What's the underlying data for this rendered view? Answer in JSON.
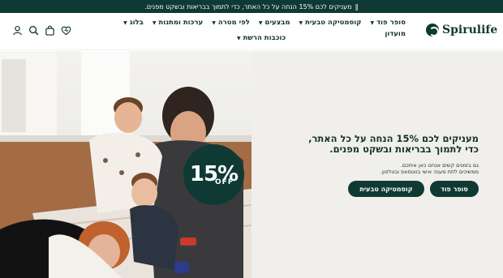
{
  "announcement": {
    "text": "מעניקים לכם 15% הנחה על כל האתר, כדי לתמוך בבריאות ובשקט מפנים.",
    "separator": "‖"
  },
  "brand": {
    "name": "Spirulife"
  },
  "nav": {
    "items": [
      {
        "label": "סופר פוד",
        "has_dropdown": true
      },
      {
        "label": "קוסמטיקה טבעית",
        "has_dropdown": true
      },
      {
        "label": "מבצעים",
        "has_dropdown": true
      },
      {
        "label": "לפי מטרה",
        "has_dropdown": true
      },
      {
        "label": "ערכות ומתנות",
        "has_dropdown": true
      },
      {
        "label": "בלוג",
        "has_dropdown": true
      },
      {
        "label": "מועדון",
        "has_dropdown": false
      }
    ],
    "row2": {
      "label": "כוכבות הרשת",
      "has_dropdown": true
    }
  },
  "header_icons": [
    "account-icon",
    "search-icon",
    "cart-icon",
    "wishlist-icon"
  ],
  "hero": {
    "headline": "מעניקים לכם 15% הנחה על כל האתר, כדי לתמוך בבריאות ובשקט מפנים.",
    "subtext_line1": "גם בזמנים קשים אנחנו כאן איתכם.",
    "subtext_line2": "ממשיכים לתת מענה אישי בווטסאפ ובטלפון.",
    "badge_number": "15%",
    "badge_text": "OFF",
    "buttons": {
      "superfood": "סופר פוד",
      "cosmetics": "קוסמטיקה טבעית"
    }
  },
  "colors": {
    "primary": "#0f3a33",
    "panel_bg": "#f1efeb",
    "text": "#12322c"
  }
}
